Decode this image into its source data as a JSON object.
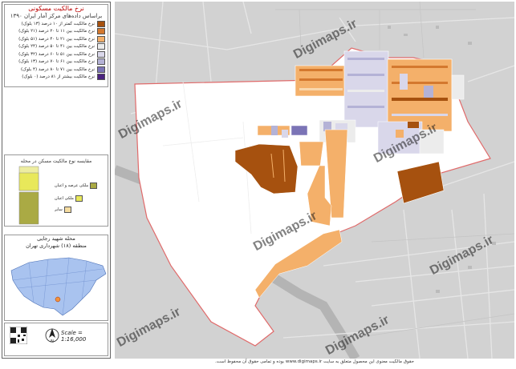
{
  "legend": {
    "title": "نرخ مالکیت مسکونی",
    "subtitle": "براساس داده‌های مرکز آمار ایران ۱۳۹۰",
    "items": [
      {
        "label": "نرخ مالکیت کمتر از ۱۰ درصد (۱۳ بلوک)",
        "color": "#a6510f"
      },
      {
        "label": "نرخ مالکیت بین ۱۱ تا ۲۰ درصد (۲۱ بلوک)",
        "color": "#d4782e"
      },
      {
        "label": "نرخ مالکیت بین ۲۱ تا ۴۰ درصد (۵۱ بلوک)",
        "color": "#f4b06a"
      },
      {
        "label": "نرخ مالکیت بین ۴۱ تا ۵۰ درصد (۲۴ بلوک)",
        "color": "#ececec"
      },
      {
        "label": "نرخ مالکیت بین ۵۱ تا ۶۰ درصد (۳۲ بلوک)",
        "color": "#d9d7ea"
      },
      {
        "label": "نرخ مالکیت بین ۶۱ تا ۷۰ درصد (۱۳ بلوک)",
        "color": "#b4b2d6"
      },
      {
        "label": "نرخ مالکیت بین ۷۱ تا ۸۰ درصد (۴ بلوک)",
        "color": "#7b74b6"
      },
      {
        "label": "نرخ مالکیت بیشتر از ۸۱ درصد (۰ بلوک)",
        "color": "#4b2380"
      }
    ]
  },
  "tenure_chart": {
    "title": "مقایسه نوع مالکیت مسکن در محله",
    "series": [
      {
        "name": "ملکی عرصه و اعیان",
        "color": "#aaaa44"
      },
      {
        "name": "ملکی اعیان",
        "color": "#e8e85a"
      },
      {
        "name": "سایر",
        "color": "#f5dca0"
      }
    ]
  },
  "location": {
    "title_line1": "محله شهید رجایی",
    "title_line2": "منطقه (۱۸) شهرداری تهران"
  },
  "scale": "Scale = 1:16,000",
  "north_label": "N",
  "watermark": "Digimaps.ir",
  "credit": "حقوق مالکیت معنوی این محصول متعلق به سایت www.digimaps.ir بوده و تمامی حقوق آن محفوظ است."
}
